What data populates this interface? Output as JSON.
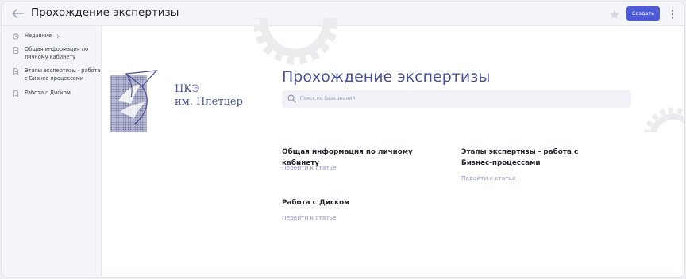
{
  "header": {
    "title": "Прохождение экспертизы",
    "create_label": "Создать"
  },
  "sidebar": {
    "items": [
      {
        "label": "Недавние",
        "icon": "clock-icon"
      },
      {
        "label": "Общая информация по личному кабинету",
        "icon": "document-icon"
      },
      {
        "label": "Этапы экспертизы - работа с Бизнес-процессами",
        "icon": "document-icon"
      },
      {
        "label": "Работа с Диском",
        "icon": "document-icon"
      }
    ]
  },
  "main": {
    "logo_text": "ЦКЭ\nим. Плетцер",
    "title": "Прохождение экспертизы",
    "search_placeholder": "Поиск по базе знаний",
    "articles": [
      {
        "title": "Общая информация по личному кабинету",
        "link": "Перейти к статье"
      },
      {
        "title": "Этапы экспертизы - работа с Бизнес-процессами",
        "link": "Перейти к статье"
      },
      {
        "title": "Работа с Диском",
        "link": "Перейти к статье"
      }
    ]
  },
  "colors": {
    "accent": "#4d5bd9",
    "brand": "#4a5192",
    "link": "#8c93c7"
  }
}
